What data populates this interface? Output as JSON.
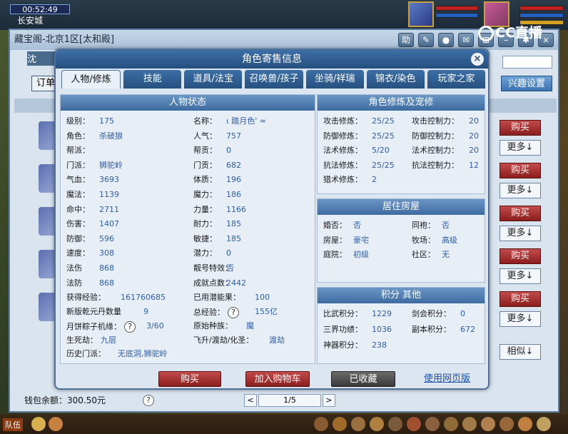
{
  "game": {
    "time": "00:52:49",
    "city": "长安城",
    "cc_label": "CC直播",
    "team": "队伍",
    "notify_count": "1"
  },
  "shop": {
    "title": "藏宝阁-北京1区[太和殿]",
    "help": "助",
    "tab_left": "沈",
    "order": "订单",
    "interest": "兴趣设置",
    "buy": "购买",
    "more": "更多↓",
    "similar": "相似↓",
    "wallet": "钱包余额：300.50元",
    "page": "1/5",
    "prev": "<",
    "next": ">",
    "question": "?"
  },
  "dialog": {
    "title": "角色寄售信息",
    "close": "×",
    "tabs": [
      "人物/修炼",
      "技能",
      "道具/法宝",
      "召唤兽/孩子",
      "坐骑/祥瑞",
      "锦衣/染色",
      "玩家之家"
    ],
    "status_title": "人物状态",
    "status_left": [
      {
        "k": "级别：",
        "v": "175"
      },
      {
        "k": "角色：",
        "v": "杀破狼"
      },
      {
        "k": "帮派：",
        "v": ""
      },
      {
        "k": "门派：",
        "v": "狮驼岭"
      },
      {
        "k": "气血：",
        "v": "3693"
      },
      {
        "k": "魔法：",
        "v": "1139"
      },
      {
        "k": "命中：",
        "v": "2711"
      },
      {
        "k": "伤害：",
        "v": "1407"
      },
      {
        "k": "防御：",
        "v": "596"
      },
      {
        "k": "速度：",
        "v": "308"
      },
      {
        "k": "法伤",
        "v": "868"
      },
      {
        "k": "法防",
        "v": "868"
      }
    ],
    "status_right": [
      {
        "k": "名称：",
        "v": "ι 踏月色' ≈"
      },
      {
        "k": "人气：",
        "v": "757"
      },
      {
        "k": "帮贡：",
        "v": "0"
      },
      {
        "k": "门贡：",
        "v": "682"
      },
      {
        "k": "体质：",
        "v": "196"
      },
      {
        "k": "魔力：",
        "v": "186"
      },
      {
        "k": "力量：",
        "v": "1166"
      },
      {
        "k": "耐力：",
        "v": "185"
      },
      {
        "k": "敏捷：",
        "v": "185"
      },
      {
        "k": "潜力：",
        "v": "0"
      },
      {
        "k": "靓号特效：",
        "v": "否"
      },
      {
        "k": "成就点数：",
        "v": "2442"
      }
    ],
    "extra_left": [
      {
        "k": "获得经验：",
        "v": "161760685"
      },
      {
        "k": "新版乾元丹数量",
        "v": "9"
      },
      {
        "k": "月饼粽子机缘：",
        "v": "3/60"
      },
      {
        "k": "生死劫：",
        "v": "九层"
      },
      {
        "k": "历史门派：",
        "v": "无底洞,狮驼岭"
      }
    ],
    "extra_right": [
      {
        "k": "已用潜能果：",
        "v": "100"
      },
      {
        "k": "总经验：",
        "v": "155亿"
      },
      {
        "k": "原始种族：",
        "v": "魔"
      },
      {
        "k": "飞升/渡劫/化圣：",
        "v": "渡劫"
      }
    ],
    "cultivation_title": "角色修炼及宠修",
    "cultivation_left": [
      {
        "k": "攻击修炼：",
        "v": "25/25"
      },
      {
        "k": "防御修炼：",
        "v": "25/25"
      },
      {
        "k": "法术修炼：",
        "v": "5/20"
      },
      {
        "k": "抗法修炼：",
        "v": "25/25"
      },
      {
        "k": "猎术修炼：",
        "v": "2"
      }
    ],
    "cultivation_right": [
      {
        "k": "攻击控制力：",
        "v": "20"
      },
      {
        "k": "防御控制力：",
        "v": "20"
      },
      {
        "k": "法术控制力：",
        "v": "20"
      },
      {
        "k": "抗法控制力：",
        "v": "12"
      }
    ],
    "house_title": "居住房屋",
    "house": [
      {
        "k": "婚否：",
        "v": "否"
      },
      {
        "k": "同袍：",
        "v": "否"
      },
      {
        "k": "房屋：",
        "v": "豪宅"
      },
      {
        "k": "牧场：",
        "v": "高级"
      },
      {
        "k": "庭院：",
        "v": "初级"
      },
      {
        "k": "社区：",
        "v": "无"
      }
    ],
    "score_title": "积分 其他",
    "score": [
      {
        "k": "比武积分：",
        "v": "1229"
      },
      {
        "k": "剑会积分：",
        "v": "0"
      },
      {
        "k": "三界功绩：",
        "v": "1036"
      },
      {
        "k": "副本积分：",
        "v": "672"
      },
      {
        "k": "神器积分：",
        "v": "238"
      }
    ],
    "buttons": {
      "buy": "购买",
      "add_cart": "加入购物车",
      "collected": "已收藏",
      "web": "使用网页版"
    }
  },
  "colors": {
    "accent": "#3e6ba0",
    "buy": "#a83030",
    "value": "#2e5ea8"
  }
}
